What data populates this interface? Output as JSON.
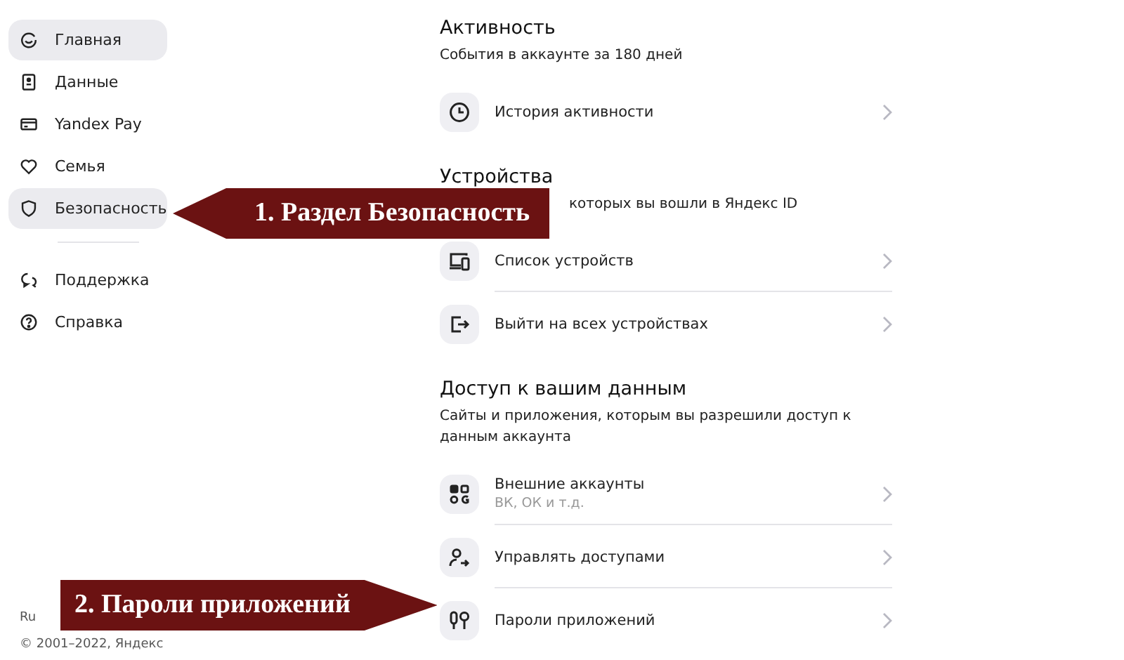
{
  "sidebar": {
    "items": [
      {
        "label": "Главная",
        "selected": true
      },
      {
        "label": "Данные",
        "selected": false
      },
      {
        "label": "Yandex Pay",
        "selected": false
      },
      {
        "label": "Семья",
        "selected": false
      },
      {
        "label": "Безопасность",
        "selected": true
      }
    ],
    "help_items": [
      {
        "label": "Поддержка"
      },
      {
        "label": "Справка"
      }
    ],
    "language": "Ru",
    "copyright": "© 2001–2022, Яндекс"
  },
  "sections": [
    {
      "title": "Активность",
      "subtitle": "События в аккаунте за 180 дней",
      "rows": [
        {
          "label": "История активности"
        }
      ]
    },
    {
      "title": "Устройства",
      "subtitle": "которых вы вошли в Яндекс ID",
      "rows": [
        {
          "label": "Список устройств"
        },
        {
          "label": "Выйти на всех устройствах"
        }
      ]
    },
    {
      "title": "Доступ к вашим данным",
      "subtitle": "Сайты и приложения, которым вы разрешили доступ к данным аккаунта",
      "rows": [
        {
          "label": "Внешние аккаунты",
          "hint": "ВК, ОК и т.д."
        },
        {
          "label": "Управлять доступами"
        },
        {
          "label": "Пароли приложений"
        }
      ]
    }
  ],
  "callouts": [
    {
      "text": "1. Раздел Безопасность"
    },
    {
      "text": "2. Пароли приложений"
    }
  ]
}
